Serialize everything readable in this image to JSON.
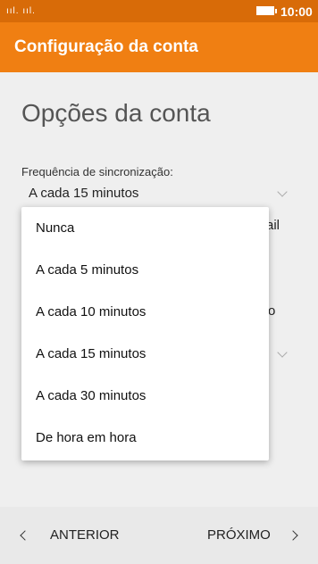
{
  "status": {
    "signal": "ııl. ııl.",
    "time": "10:00",
    "icons": [
      "signal-icon",
      "battery-icon"
    ]
  },
  "app_bar": {
    "title": "Configuração da conta"
  },
  "main": {
    "heading": "Opções da conta",
    "sync_label": "Frequência de sincronização:",
    "sync_value": "A cada 15 minutos",
    "partial_text_1": "ail",
    "partial_text_2": "o"
  },
  "dropdown": {
    "options": [
      "Nunca",
      "A cada 5 minutos",
      "A cada 10 minutos",
      "A cada 15 minutos",
      "A cada 30 minutos",
      "De hora em hora"
    ]
  },
  "nav": {
    "prev_label": "ANTERIOR",
    "next_label": "PRÓXIMO"
  },
  "colors": {
    "status_bar": "#d86b08",
    "app_bar": "#f07f12"
  }
}
